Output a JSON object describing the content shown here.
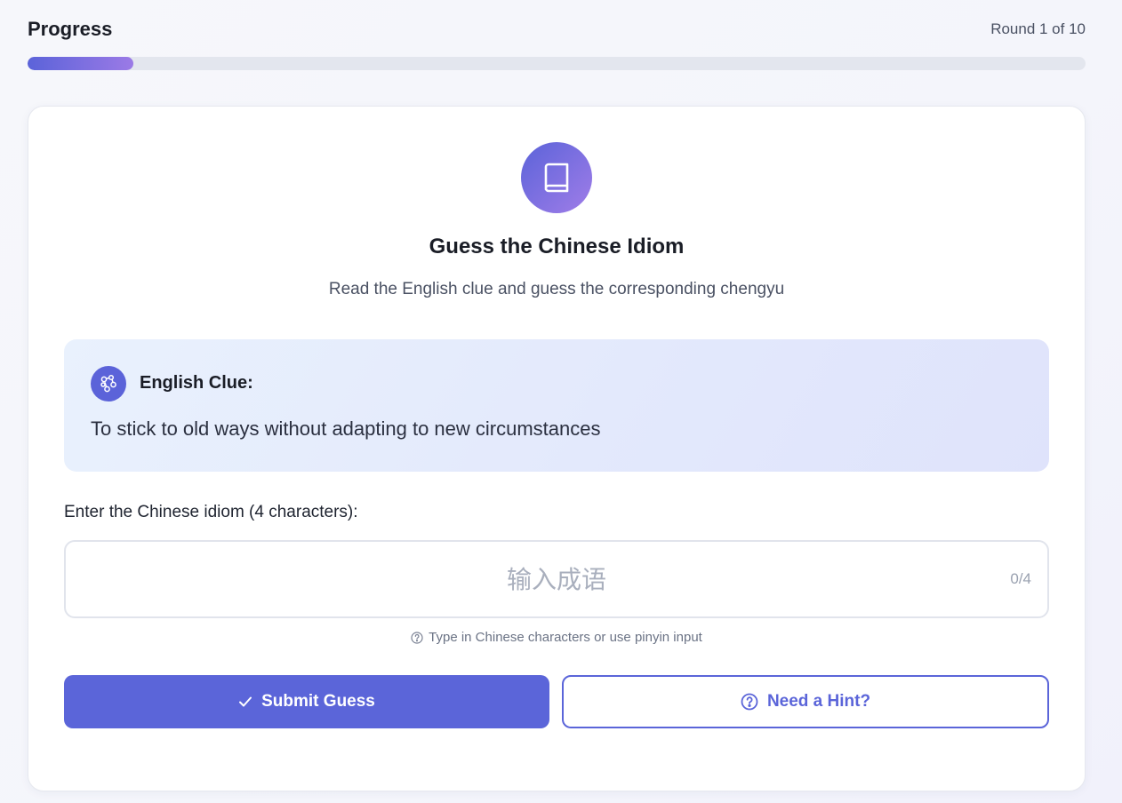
{
  "progress": {
    "title": "Progress",
    "round_text": "Round 1 of 10",
    "fraction": 0.1
  },
  "card": {
    "icon": "book-icon",
    "title": "Guess the Chinese Idiom",
    "subtitle": "Read the English clue and guess the corresponding chengyu"
  },
  "clue": {
    "icon": "molecule-icon",
    "label": "English Clue:",
    "text": "To stick to old ways without adapting to new circumstances"
  },
  "input": {
    "label": "Enter the Chinese idiom (4 characters):",
    "placeholder": "输入成语",
    "value": "",
    "count": "0/4",
    "helper_icon": "question-circle-icon",
    "helper": "Type in Chinese characters or use pinyin input"
  },
  "buttons": {
    "submit_icon": "check-icon",
    "submit_label": "Submit Guess",
    "hint_icon": "question-circle-icon",
    "hint_label": "Need a Hint?"
  },
  "colors": {
    "accent": "#5b65d9",
    "gradient_end": "#a07de8",
    "track": "#e3e6ee"
  }
}
